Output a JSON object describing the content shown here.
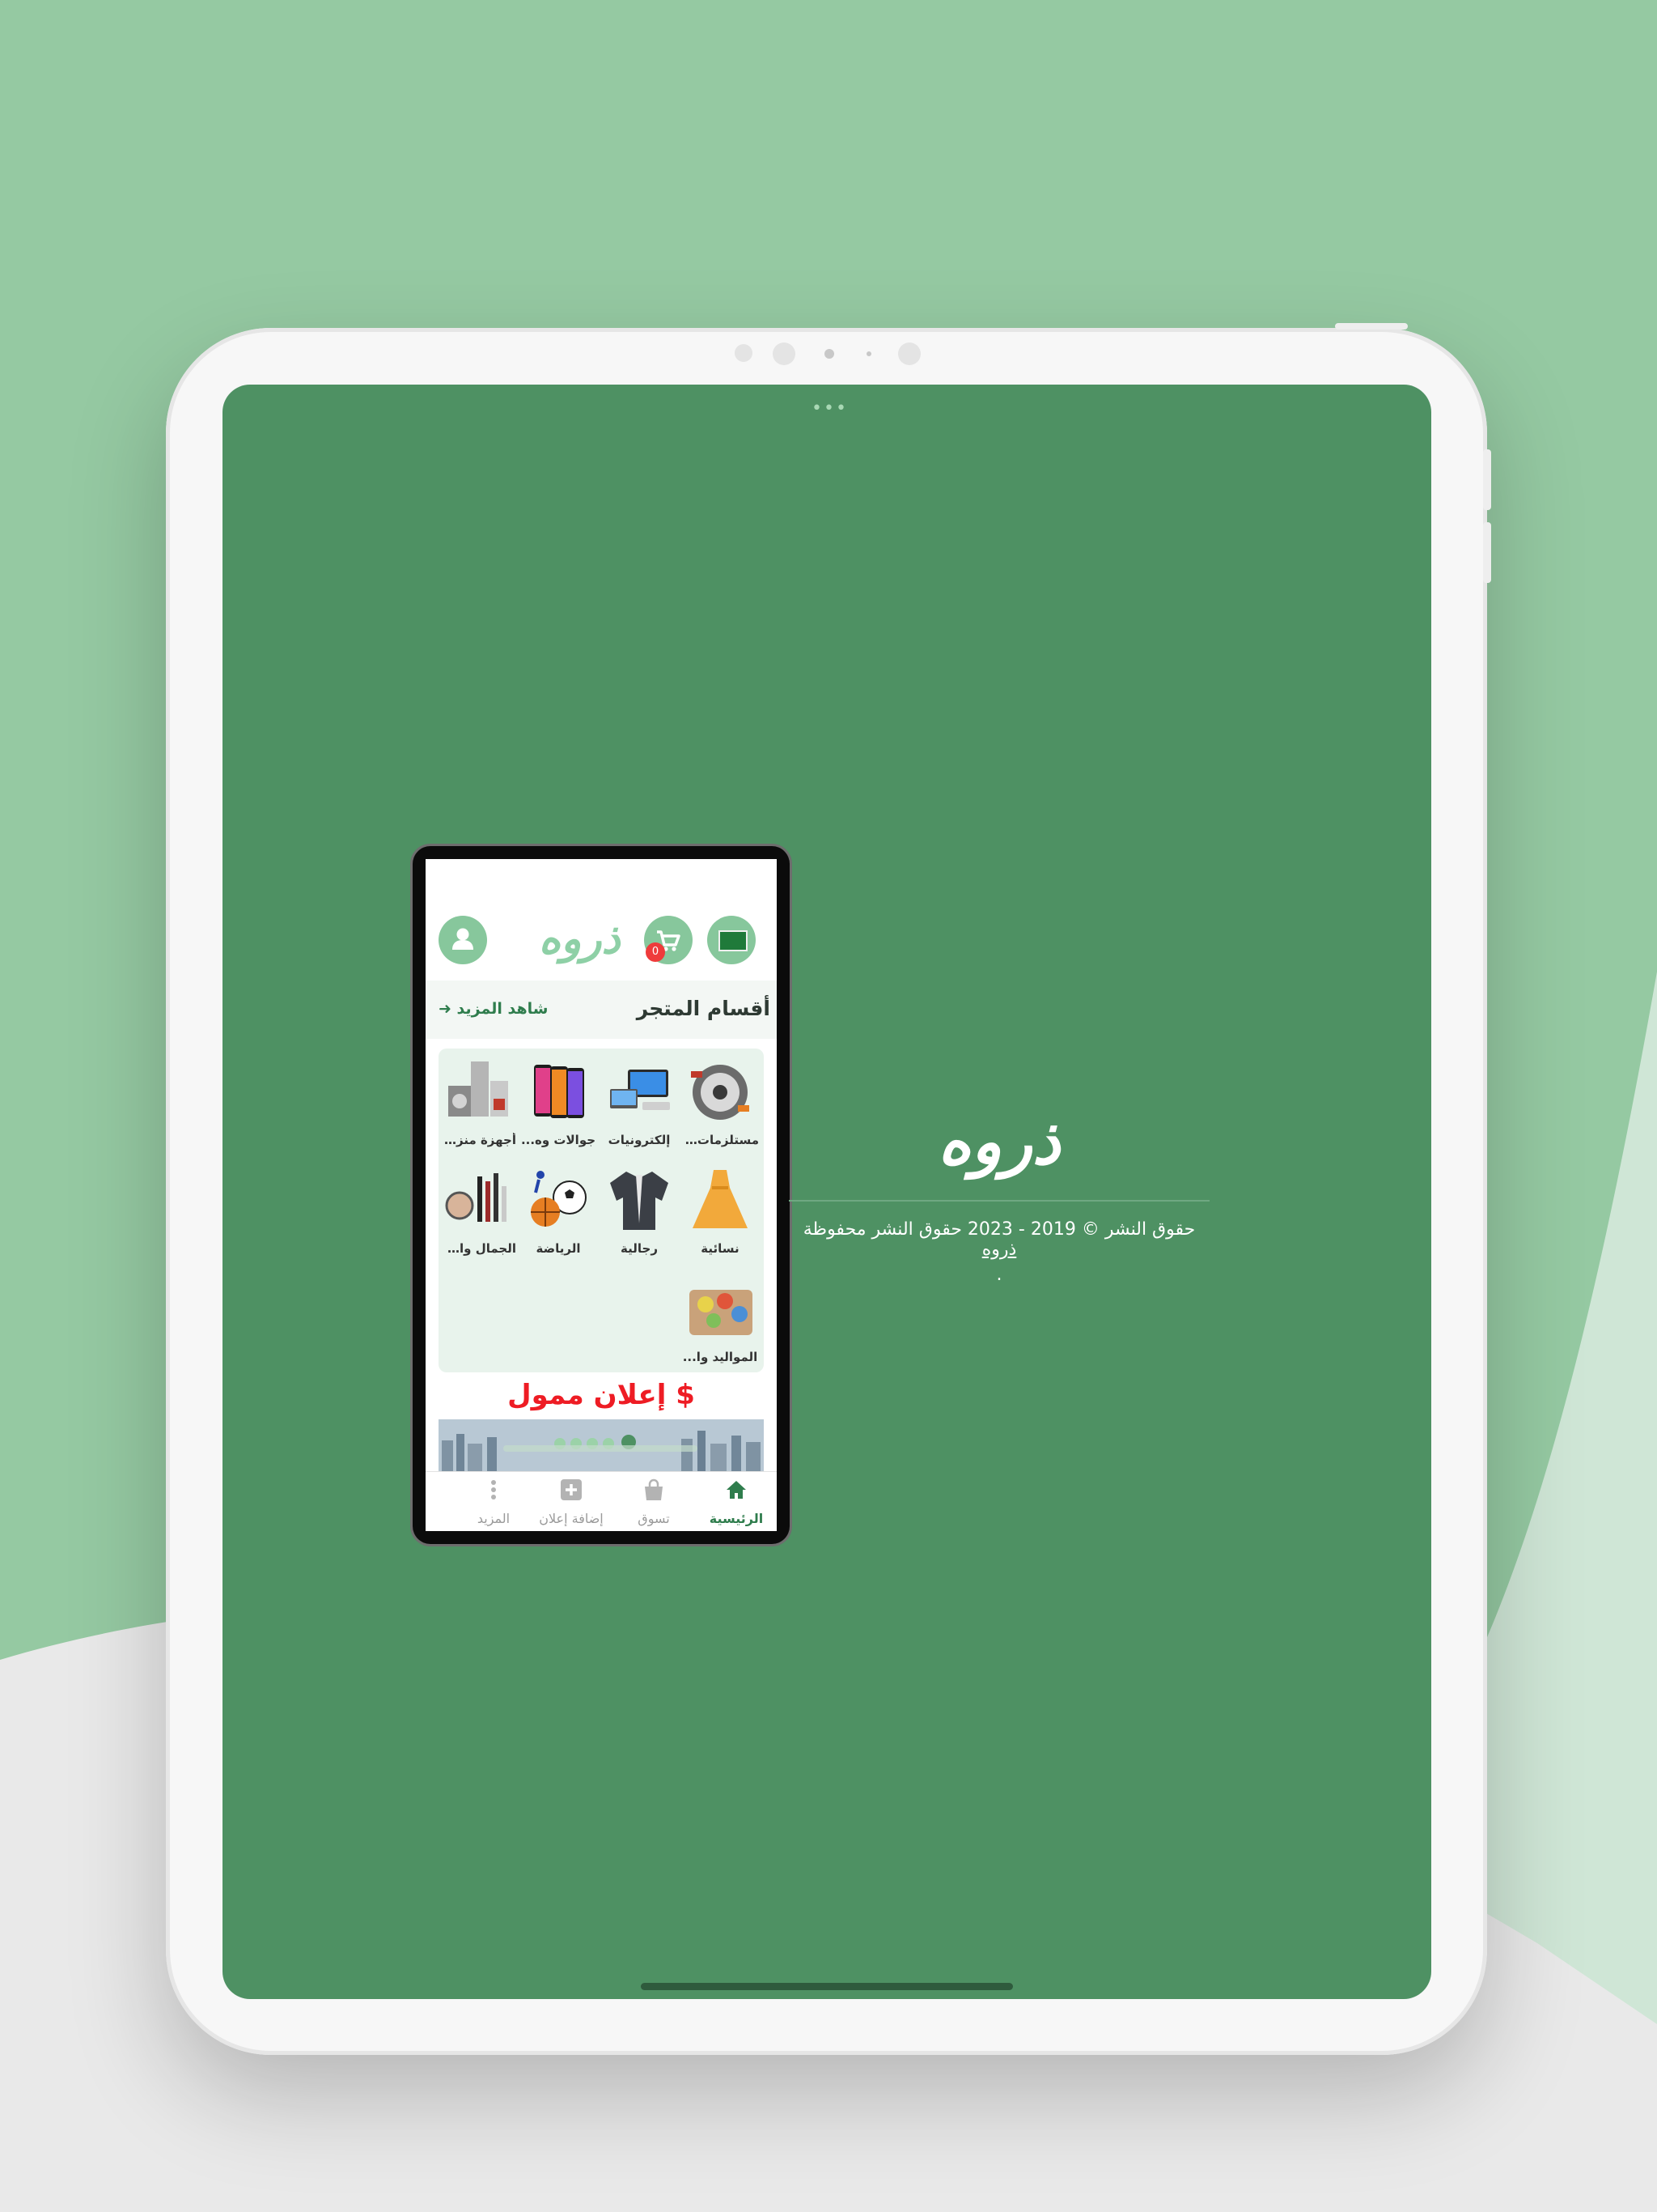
{
  "right_panel": {
    "brand": "ذروه",
    "copyright_prefix": "حقوق النشر © 2019 - 2023 حقوق النشر محفوظة",
    "copyright_brand": "ذروه",
    "copyright_suffix": "."
  },
  "phone": {
    "header": {
      "logo": "ذروه",
      "cart_count": "0",
      "flag_icon": "saudi-flag-icon",
      "cart_icon": "cart-icon",
      "user_icon": "user-icon"
    },
    "section": {
      "title": "أقسام المتجر",
      "see_more": "شاهد المزيد"
    },
    "categories": [
      {
        "label": "مستلزمات ..."
      },
      {
        "label": "إلكترونيات"
      },
      {
        "label": "جوالات وه..."
      },
      {
        "label": "أجهزة منزل..."
      },
      {
        "label": "نسائية"
      },
      {
        "label": "رجالية"
      },
      {
        "label": "الرياضة"
      },
      {
        "label": "الجمال وال..."
      },
      {
        "label": "المواليد وا..."
      }
    ],
    "ad": {
      "title": "$ إعلان ممول"
    },
    "bottom_nav": [
      {
        "label": "الرئيسية",
        "icon": "home-icon",
        "active": true
      },
      {
        "label": "تسوق",
        "icon": "shopping-bag-icon",
        "active": false
      },
      {
        "label": "إضافة إعلان",
        "icon": "add-icon",
        "active": false
      },
      {
        "label": "المزيد",
        "icon": "more-vertical-icon",
        "active": false
      }
    ]
  },
  "colors": {
    "background": "#95c9a2",
    "screen": "#4e9163",
    "accent": "#2f7d4d",
    "ad_red": "#ee1c24",
    "badge_red": "#ef3b3b"
  }
}
